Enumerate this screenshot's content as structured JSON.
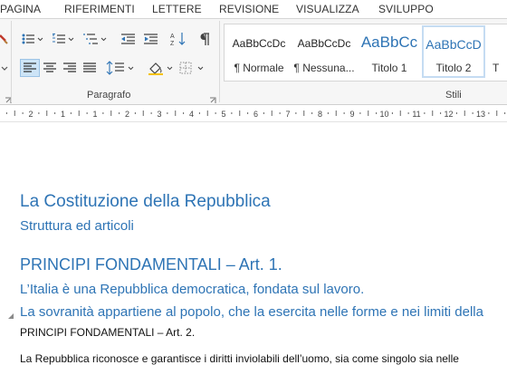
{
  "ribbon_tabs": [
    "PAGINA",
    "RIFERIMENTI",
    "LETTERE",
    "REVISIONE",
    "VISUALIZZA",
    "SVILUPPO"
  ],
  "groups": {
    "paragraph": "Paragrafo",
    "styles": "Stili"
  },
  "styles": [
    {
      "preview": "AaBbCcDc",
      "name": "¶ Normale"
    },
    {
      "preview": "AaBbCcDc",
      "name": "¶ Nessuna..."
    },
    {
      "preview": "AaBbCc",
      "name": "Titolo 1"
    },
    {
      "preview": "AaBbCcD",
      "name": "Titolo 2"
    },
    {
      "preview": "",
      "name": "T"
    }
  ],
  "ruler": {
    "labels": [
      "2",
      "1",
      "1",
      "2",
      "3",
      "4",
      "5",
      "6",
      "7",
      "8",
      "9",
      "10",
      "11",
      "12",
      "13",
      "14"
    ]
  },
  "document": {
    "title": "La Costituzione della Repubblica",
    "subtitle": "Struttura ed articoli",
    "heading1": "PRINCIPI FONDAMENTALI – Art. 1.",
    "heading2": "L’Italia è una Repubblica democratica, fondata sul lavoro.",
    "heading3": "La sovranità appartiene al popolo, che la esercita nelle forme e nei limiti della",
    "heading4": "PRINCIPI FONDAMENTALI – Art. 2.",
    "body1": "La Repubblica riconosce e garantisce i diritti inviolabili dell’uomo, sia come singolo sia nelle"
  },
  "colors": {
    "accent": "#2e74b5",
    "selected_button": "#cde4f7"
  }
}
